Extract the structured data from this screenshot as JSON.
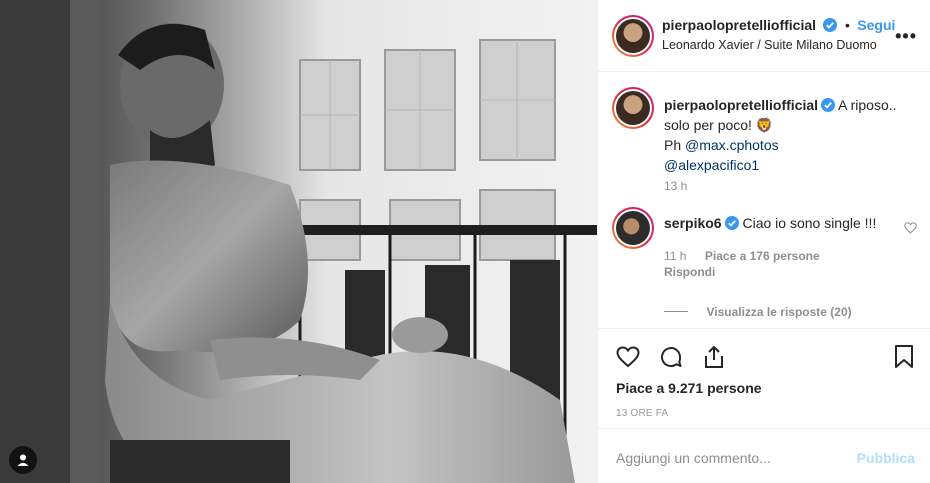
{
  "header": {
    "username": "pierpaolopretelliofficial",
    "follow_label": "Segui",
    "location": "Leonardo Xavier / Suite Milano Duomo",
    "more_label": "•••"
  },
  "caption": {
    "username": "pierpaolopretelliofficial",
    "text_line1": "A riposo..",
    "text_line2": "solo per poco! 🦁",
    "credit_prefix": "Ph",
    "mention1": "@max.cphotos",
    "mention2": "@alexpacifico1",
    "time": "13 h"
  },
  "comments": [
    {
      "username": "serpiko6",
      "text": "Ciao io sono single !!!",
      "time": "11 h",
      "likes": "Piace a 176 persone",
      "reply_label": "Rispondi",
      "view_replies": "Visualizza le risposte (20)"
    }
  ],
  "actions": {
    "like_icon": "heart-icon",
    "comment_icon": "comment-icon",
    "share_icon": "share-icon",
    "save_icon": "bookmark-icon"
  },
  "likes_text": "Piace a 9.271 persone",
  "timestamp": "13 ORE FA",
  "add_comment": {
    "placeholder": "Aggiungi un commento...",
    "publish_label": "Pubblica"
  },
  "colors": {
    "link": "#003569",
    "accent": "#3897f0",
    "publish_disabled": "#b2dffc",
    "muted": "#8e8e8e",
    "border": "#efefef"
  }
}
